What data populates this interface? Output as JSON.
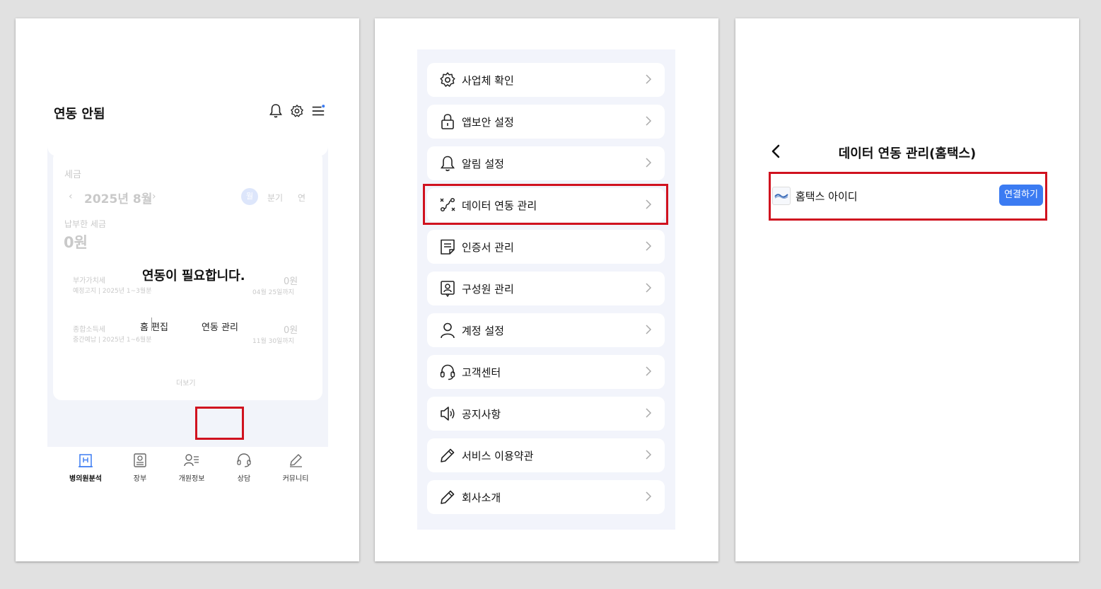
{
  "panel1": {
    "title": "연동 안됨",
    "tax_section_label": "세금",
    "month_prev": "‹",
    "month": "2025년 8월",
    "month_next": "›",
    "period_tabs": [
      "월",
      "분기",
      "연"
    ],
    "paid_label": "납부한 세금",
    "paid_value": "0원",
    "tax_rows": [
      {
        "title": "부가가치세",
        "sub": "예정고지 | 2025년 1~3월분",
        "value": "0원",
        "due": "04월 25일까지"
      },
      {
        "title": "종합소득세",
        "sub": "중간예납 | 2025년 1~6월분",
        "value": "0원",
        "due": "11월 30일까지"
      }
    ],
    "more": "더보기",
    "need_link_message": "연동이 필요합니다.",
    "home_edit": "홈 편집",
    "link_manage": "연동 관리",
    "nav": [
      {
        "label": "병의원분석",
        "icon": "hospital-icon",
        "active": true
      },
      {
        "label": "장부",
        "icon": "ledger-icon",
        "active": false
      },
      {
        "label": "개원정보",
        "icon": "person-list-icon",
        "active": false
      },
      {
        "label": "상담",
        "icon": "headset-icon",
        "active": false
      },
      {
        "label": "커뮤니티",
        "icon": "pen-icon",
        "active": false
      }
    ]
  },
  "panel2": {
    "menu": [
      {
        "label": "사업체 확인",
        "icon": "gear-icon"
      },
      {
        "label": "앱보안 설정",
        "icon": "lock-icon"
      },
      {
        "label": "알림 설정",
        "icon": "bell-icon"
      },
      {
        "label": "데이터 연동 관리",
        "icon": "link-icon",
        "highlighted": true
      },
      {
        "label": "인증서 관리",
        "icon": "certificate-icon"
      },
      {
        "label": "구성원 관리",
        "icon": "member-badge-icon"
      },
      {
        "label": "계정 설정",
        "icon": "user-icon"
      },
      {
        "label": "고객센터",
        "icon": "headset-icon"
      },
      {
        "label": "공지사항",
        "icon": "speaker-icon"
      },
      {
        "label": "서비스 이용약관",
        "icon": "pen-icon"
      },
      {
        "label": "회사소개",
        "icon": "pen-icon"
      }
    ]
  },
  "panel3": {
    "title": "데이터 연동 관리(홈택스)",
    "hometax_label": "홈택스 아이디",
    "connect_button": "연결하기"
  },
  "colors": {
    "accent": "#3b7bf2",
    "highlight": "#d0121f",
    "panel_bg": "#f2f4fb"
  }
}
